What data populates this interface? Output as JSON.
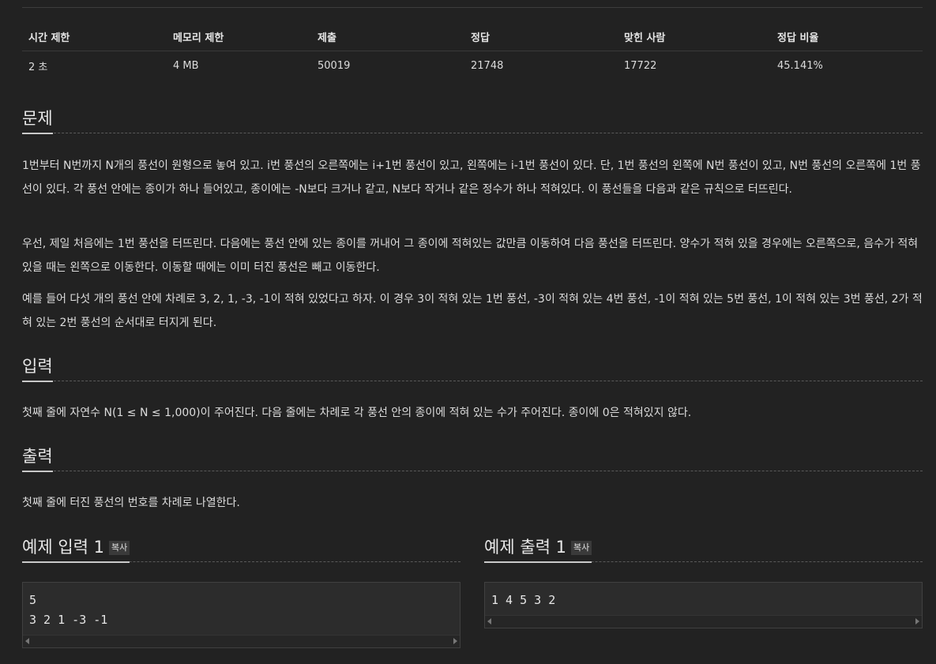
{
  "stats": {
    "headers": [
      "시간 제한",
      "메모리 제한",
      "제출",
      "정답",
      "맞힌 사람",
      "정답 비율"
    ],
    "values": [
      "2 초",
      "4 MB",
      "50019",
      "21748",
      "17722",
      "45.141%"
    ]
  },
  "problem": {
    "title": "문제",
    "paragraphs": [
      "1번부터 N번까지 N개의 풍선이 원형으로 놓여 있고. i번 풍선의 오른쪽에는 i+1번 풍선이 있고, 왼쪽에는 i-1번 풍선이 있다. 단, 1번 풍선의 왼쪽에 N번 풍선이 있고, N번 풍선의 오른쪽에 1번 풍선이 있다. 각 풍선 안에는 종이가 하나 들어있고, 종이에는 -N보다 크거나 같고, N보다 작거나 같은 정수가 하나 적혀있다. 이 풍선들을 다음과 같은 규칙으로 터뜨린다.",
      "우선, 제일 처음에는 1번 풍선을 터뜨린다. 다음에는 풍선 안에 있는 종이를 꺼내어 그 종이에 적혀있는 값만큼 이동하여 다음 풍선을 터뜨린다. 양수가 적혀 있을 경우에는 오른쪽으로, 음수가 적혀 있을 때는 왼쪽으로 이동한다. 이동할 때에는 이미 터진 풍선은 빼고 이동한다.",
      "예를 들어 다섯 개의 풍선 안에 차례로 3, 2, 1, -3, -1이 적혀 있었다고 하자. 이 경우 3이 적혀 있는 1번 풍선, -3이 적혀 있는 4번 풍선, -1이 적혀 있는 5번 풍선, 1이 적혀 있는 3번 풍선, 2가 적혀 있는 2번 풍선의 순서대로 터지게 된다."
    ]
  },
  "input": {
    "title": "입력",
    "text": "첫째 줄에 자연수 N(1 ≤ N ≤ 1,000)이 주어진다. 다음 줄에는 차례로 각 풍선 안의 종이에 적혀 있는 수가 주어진다. 종이에 0은 적혀있지 않다."
  },
  "output": {
    "title": "출력",
    "text": "첫째 줄에 터진 풍선의 번호를 차례로 나열한다."
  },
  "sample_input": {
    "title": "예제 입력 1",
    "copy_label": "복사",
    "code": "5\n3 2 1 -3 -1"
  },
  "sample_output": {
    "title": "예제 출력 1",
    "copy_label": "복사",
    "code": "1 4 5 3 2"
  }
}
